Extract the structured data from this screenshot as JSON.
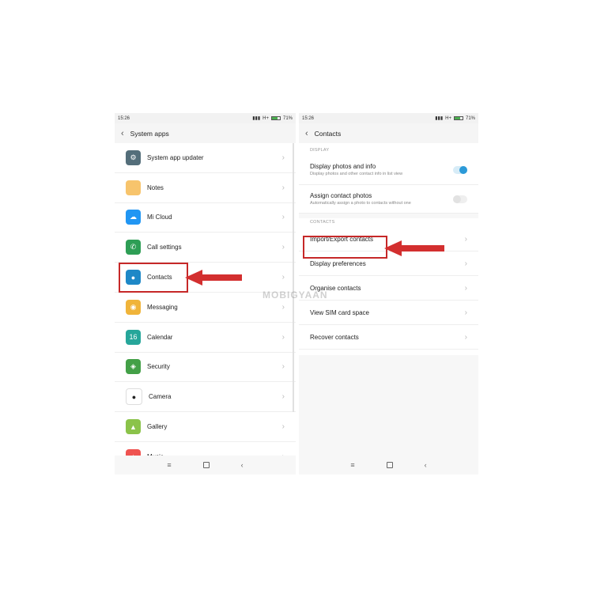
{
  "left": {
    "status": {
      "time": "15:26",
      "network": "H+",
      "battery_text": "71%",
      "battery_level": 0.71
    },
    "header": {
      "back": "‹",
      "title": "System apps"
    },
    "items": [
      {
        "label": "System app updater",
        "icon": "gear-icon",
        "color": "#546e7a",
        "glyph": "⚙"
      },
      {
        "label": "Notes",
        "icon": "notes-icon",
        "color": "#f7c46c",
        "glyph": ""
      },
      {
        "label": "Mi Cloud",
        "icon": "cloud-icon",
        "color": "#2196f3",
        "glyph": "☁"
      },
      {
        "label": "Call settings",
        "icon": "phone-icon",
        "color": "#2e9e55",
        "glyph": "✆"
      },
      {
        "label": "Contacts",
        "icon": "contacts-icon",
        "color": "#1e88c7",
        "glyph": "●"
      },
      {
        "label": "Messaging",
        "icon": "message-icon",
        "color": "#f0b43a",
        "glyph": "◉"
      },
      {
        "label": "Calendar",
        "icon": "calendar-icon",
        "color": "#26a69a",
        "glyph": "16"
      },
      {
        "label": "Security",
        "icon": "shield-icon",
        "color": "#43a047",
        "glyph": "◈"
      },
      {
        "label": "Camera",
        "icon": "camera-icon",
        "color": "#ffffff",
        "glyph": "●"
      },
      {
        "label": "Gallery",
        "icon": "gallery-icon",
        "color": "#8bc34a",
        "glyph": "▲"
      },
      {
        "label": "Music",
        "icon": "music-icon",
        "color": "#ef5350",
        "glyph": "♪"
      }
    ],
    "chevron": "›"
  },
  "right": {
    "status": {
      "time": "15:26",
      "network": "H+",
      "battery_text": "71%",
      "battery_level": 0.71
    },
    "header": {
      "back": "‹",
      "title": "Contacts"
    },
    "display_section": "DISPLAY",
    "display_photos": {
      "title": "Display photos and info",
      "desc": "Display photos and other contact info in list view",
      "on": true
    },
    "assign_photos": {
      "title": "Assign contact photos",
      "desc": "Automatically assign a photo to contacts without one",
      "on": false
    },
    "contacts_section": "CONTACTS",
    "items": [
      {
        "label": "Import/Export contacts"
      },
      {
        "label": "Display preferences"
      },
      {
        "label": "Organise contacts"
      },
      {
        "label": "View SIM card space"
      },
      {
        "label": "Recover contacts"
      }
    ],
    "chevron": "›"
  },
  "nav": {
    "menu": "≡",
    "back": "‹"
  },
  "watermark": "MOBIGYAAN",
  "colors": {
    "highlight": "#c62828",
    "arrow": "#d32f2f",
    "toggle_on": "#2c9ad8"
  }
}
